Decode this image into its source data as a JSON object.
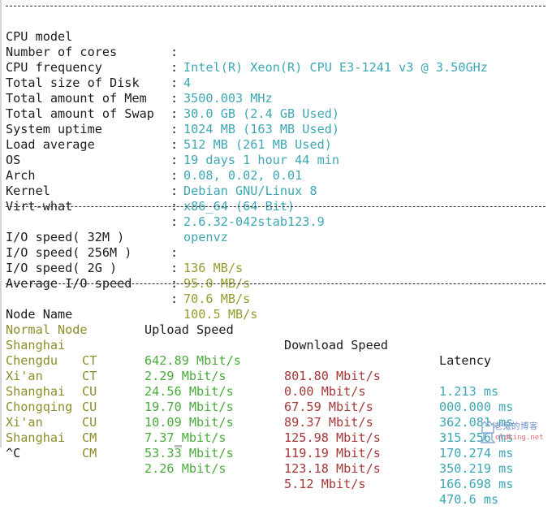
{
  "terminal": {
    "system_info": [
      {
        "label": "CPU model",
        "value": "Intel(R) Xeon(R) CPU E3-1241 v3 @ 3.50GHz"
      },
      {
        "label": "Number of cores",
        "value": "4"
      },
      {
        "label": "CPU frequency",
        "value": "3500.003 MHz"
      },
      {
        "label": "Total size of Disk",
        "value": "30.0 GB (2.4 GB Used)"
      },
      {
        "label": "Total amount of Mem",
        "value": "1024 MB (163 MB Used)"
      },
      {
        "label": "Total amount of Swap",
        "value": "512 MB (261 MB Used)"
      },
      {
        "label": "System uptime",
        "value": "19 days 1 hour 44 min"
      },
      {
        "label": "Load average",
        "value": "0.08, 0.02, 0.01"
      },
      {
        "label": "OS",
        "value": "Debian GNU/Linux 8"
      },
      {
        "label": "Arch",
        "value": "x86_64 (64 Bit)"
      },
      {
        "label": "Kernel",
        "value": "2.6.32-042stab123.9"
      },
      {
        "label": "Virt-what",
        "value": "openvz"
      }
    ],
    "io_info": [
      {
        "label": "I/O speed( 32M )",
        "value": "136 MB/s"
      },
      {
        "label": "I/O speed( 256M )",
        "value": "95.0 MB/s"
      },
      {
        "label": "I/O speed( 2G )",
        "value": "70.6 MB/s"
      },
      {
        "label": "Average I/O speed",
        "value": "100.5 MB/s"
      }
    ],
    "separator_char": ":",
    "speed_table": {
      "headers": [
        "Node Name",
        "Upload Speed",
        "Download Speed",
        "Latency"
      ],
      "rows": [
        {
          "node": "Normal Node",
          "isp": "",
          "upload": "642.89 Mbit/s",
          "download": "801.80 Mbit/s",
          "latency": "1.213 ms"
        },
        {
          "node": "Shanghai",
          "isp": "CT",
          "upload": "2.29 Mbit/s",
          "download": "0.00 Mbit/s",
          "latency": "000.000 ms"
        },
        {
          "node": "Chengdu",
          "isp": "CT",
          "upload": "24.56 Mbit/s",
          "download": "67.59 Mbit/s",
          "latency": "362.081 ms"
        },
        {
          "node": "Xi'an",
          "isp": "CU",
          "upload": "19.70 Mbit/s",
          "download": "89.37 Mbit/s",
          "latency": "315.256 ms"
        },
        {
          "node": "Shanghai",
          "isp": "CU",
          "upload": "10.09 Mbit/s",
          "download": "125.98 Mbit/s",
          "latency": "170.274 ms"
        },
        {
          "node": "Chongqing",
          "isp": "CU",
          "upload": "7.37 Mbit/s",
          "download": "119.19 Mbit/s",
          "latency": "350.219 ms"
        },
        {
          "node": "Xi'an",
          "isp": "CM",
          "upload": "53.33 Mbit/s",
          "download": "123.18 Mbit/s",
          "latency": "166.698 ms"
        },
        {
          "node": "Shanghai",
          "isp": "CM",
          "upload": "2.26 Mbit/s",
          "download": "5.12 Mbit/s",
          "latency": "470.6 ms"
        }
      ]
    },
    "interrupt": "^C"
  },
  "watermark": {
    "title": "老鬼的博客",
    "url": "oldking.net"
  },
  "colors": {
    "label": "#1c1c1c",
    "info_value": "#3ea7b4",
    "io_value": "#979a2f",
    "node_name": "#8e8c2a",
    "upload": "#4aab3c",
    "download": "#a53838",
    "latency": "#3ea7b4"
  }
}
